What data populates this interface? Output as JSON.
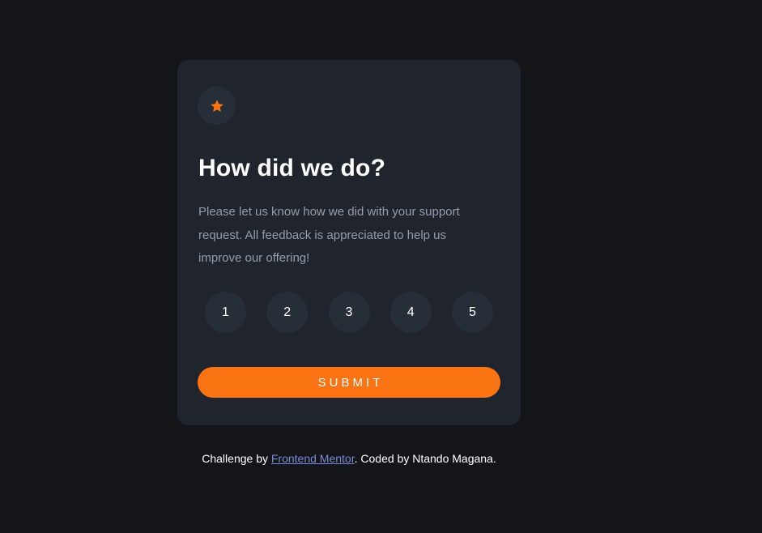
{
  "colors": {
    "page_background": "#131518",
    "card_background": "#1f242d",
    "circle_background": "#262e38",
    "accent": "#fb7413",
    "muted_text": "#959eac",
    "link": "#7b89d8"
  },
  "card": {
    "icon": "star-icon",
    "title": "How did we do?",
    "description": "Please let us know how we did with your support request. All feedback is appreciated to help us improve our offering!",
    "ratings": [
      "1",
      "2",
      "3",
      "4",
      "5"
    ],
    "submit_label": "SUBMIT"
  },
  "attribution": {
    "prefix": "Challenge by ",
    "link_text": "Frontend Mentor",
    "suffix": ". Coded by Ntando Magana."
  }
}
